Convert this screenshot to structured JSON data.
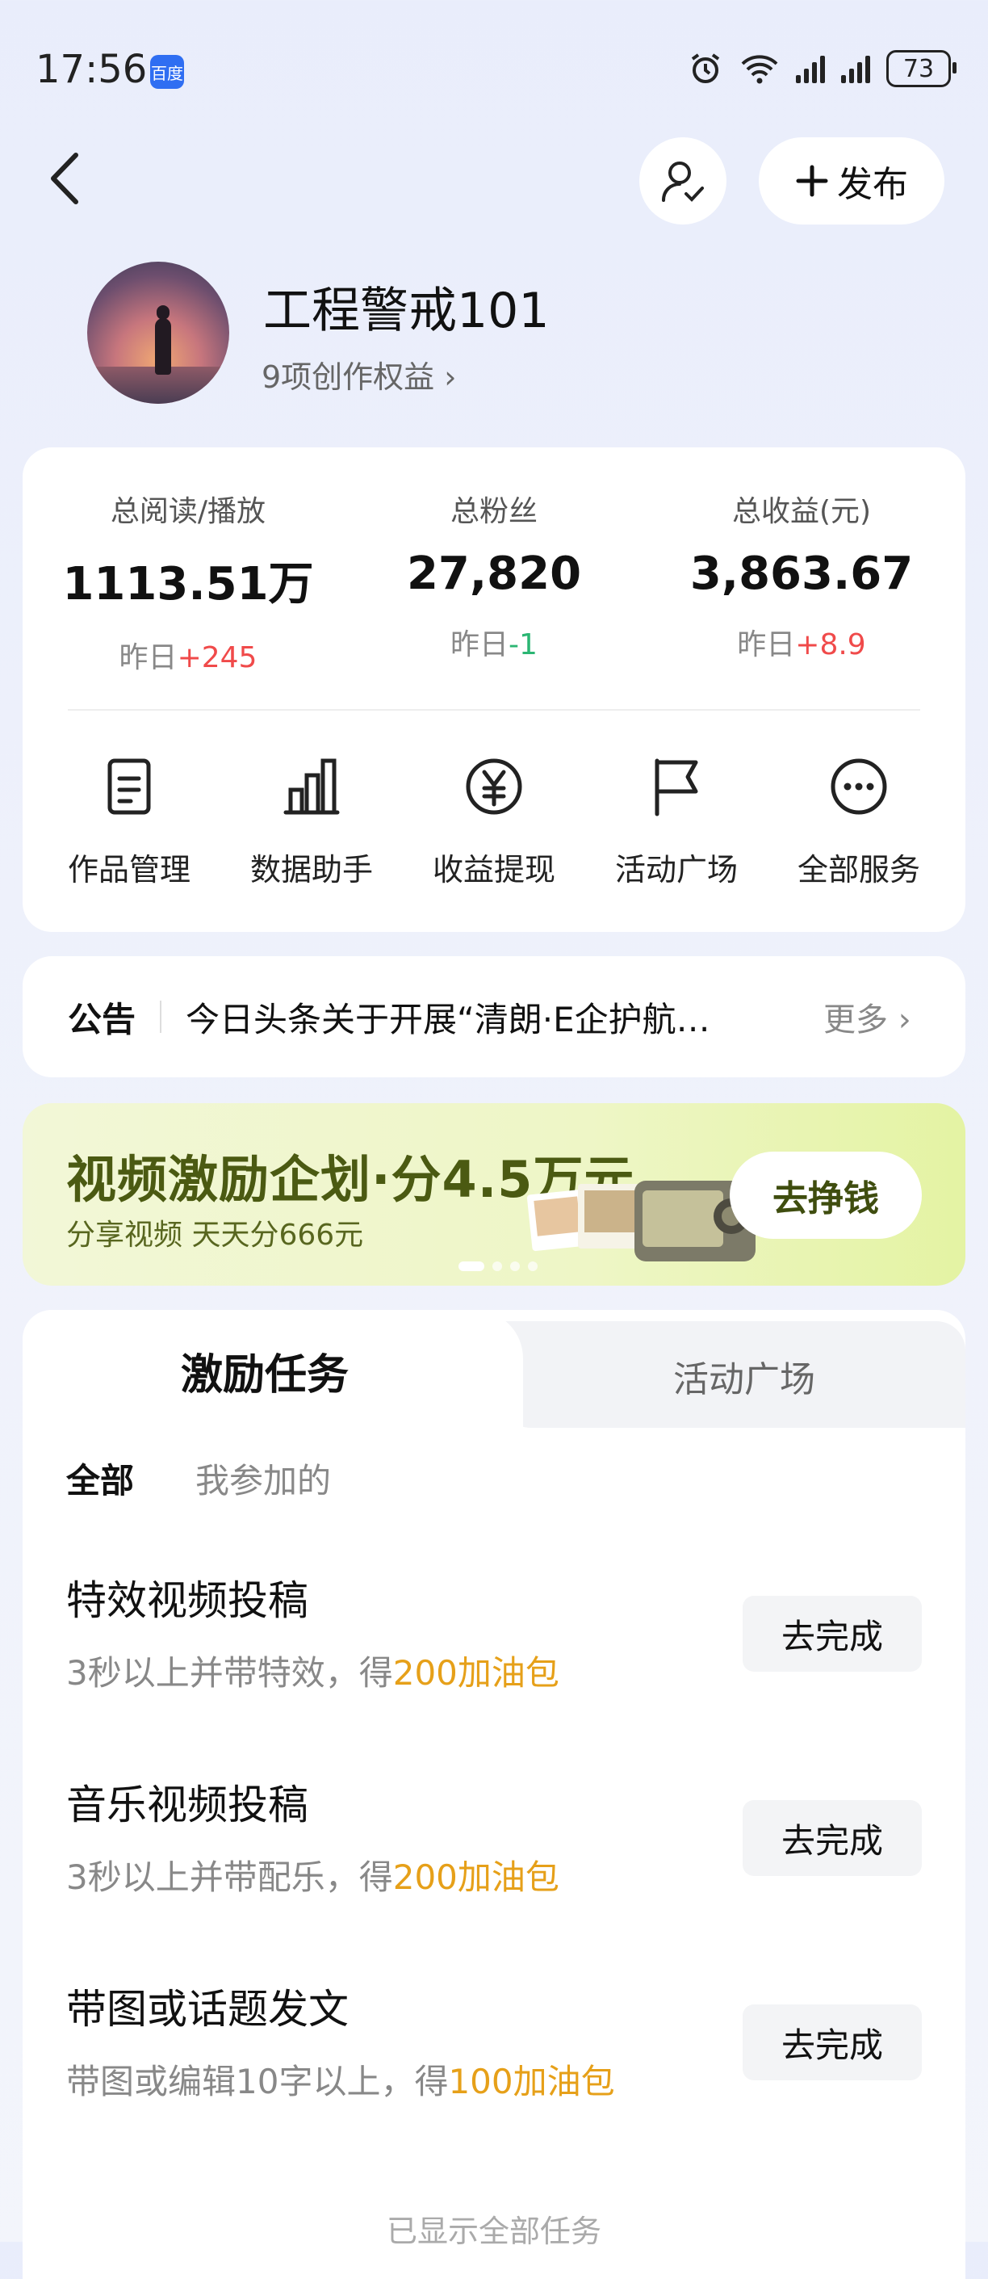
{
  "status": {
    "time": "17:56",
    "badge": "百度",
    "battery": "73"
  },
  "header": {
    "publish_label": "发布"
  },
  "profile": {
    "username": "工程警戒101",
    "benefits": "9项创作权益 ›"
  },
  "stats": [
    {
      "label": "总阅读/播放",
      "value": "1113.51万",
      "delta_prefix": "昨日",
      "delta": "+245",
      "delta_color": "#f04a4a"
    },
    {
      "label": "总粉丝",
      "value": "27,820",
      "delta_prefix": "昨日",
      "delta": "-1",
      "delta_color": "#2bb673"
    },
    {
      "label": "总收益(元)",
      "value": "3,863.67",
      "delta_prefix": "昨日",
      "delta": "+8.9",
      "delta_color": "#f04a4a"
    }
  ],
  "services": [
    {
      "label": "作品管理",
      "icon": "document-icon"
    },
    {
      "label": "数据助手",
      "icon": "bar-chart-icon"
    },
    {
      "label": "收益提现",
      "icon": "yen-icon"
    },
    {
      "label": "活动广场",
      "icon": "flag-icon"
    },
    {
      "label": "全部服务",
      "icon": "more-icon"
    }
  ],
  "notice": {
    "tag": "公告",
    "text": "今日头条关于开展“清朗·E企护航…",
    "more": "更多 ›"
  },
  "banner": {
    "title": "视频激励企划·分4.5万元",
    "subtitle": "分享视频 天天分666元",
    "cta": "去挣钱"
  },
  "tabs": {
    "active": "激励任务",
    "inactive": "活动广场"
  },
  "filters": {
    "all": "全部",
    "joined": "我参加的"
  },
  "tasks": [
    {
      "name": "特效视频投稿",
      "desc": "3秒以上并带特效，得",
      "reward": "200加油包",
      "button": "去完成"
    },
    {
      "name": "音乐视频投稿",
      "desc": "3秒以上并带配乐，得",
      "reward": "200加油包",
      "button": "去完成"
    },
    {
      "name": "带图或话题发文",
      "desc": "带图或编辑10字以上，得",
      "reward": "100加油包",
      "button": "去完成"
    }
  ],
  "footer": "已显示全部任务"
}
